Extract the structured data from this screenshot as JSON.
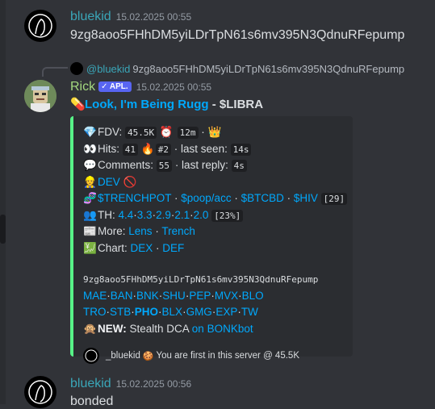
{
  "messages": [
    {
      "author": "bluekid",
      "timestamp": "15.02.2025 00:55",
      "text": "9zg8aoo5FHhDM5yiLDrTpN61s6mv395N3QdnuRFepump"
    },
    {
      "reply": {
        "author": "@bluekid",
        "text": "9zg8aoo5FHhDM5yiLDrTpN61s6mv395N3QdnuRFepump"
      },
      "author": "Rick",
      "badge": "APL.",
      "timestamp": "15.02.2025 00:55",
      "title": {
        "icon": "pill-icon",
        "link": "Look, I'm Being Rugg",
        "sep": " - ",
        "rest": "$LIBRA"
      },
      "embed": {
        "accent": "#57f287",
        "fdv": {
          "label": "FDV:",
          "value": "45.5K",
          "age": "12m"
        },
        "hits": {
          "label": "Hits:",
          "value": "41",
          "rank": "#2",
          "last_seen_label": "· last seen:",
          "last_seen": "14s"
        },
        "comments": {
          "label": "Comments:",
          "value": "55",
          "last_reply_label": "· last reply:",
          "last_reply": "4s"
        },
        "dev": {
          "label": "DEV"
        },
        "links_row": {
          "a": "$TRENCHPOT",
          "b": "$poop/acc",
          "c": "$BTCBD",
          "d": "$HIV",
          "count": "[29]"
        },
        "th": {
          "label": "TH:",
          "values": [
            "4.4",
            "3.3",
            "2.9",
            "2.1",
            "2.0"
          ],
          "pct": "[23%]"
        },
        "more": {
          "label": "More:",
          "a": "Lens",
          "b": "Trench"
        },
        "chart": {
          "label": "Chart:",
          "a": "DEX",
          "b": "DEF"
        },
        "address": "9zg8aoo5FHhDM5yiLDrTpN61s6mv395N3QdnuRFepump",
        "row1": [
          "MAE",
          "BAN",
          "BNK",
          "SHU",
          "PEP",
          "MVX",
          "BLO"
        ],
        "row2": [
          "TRO",
          "STB",
          "PHO",
          "BLX",
          "GMG",
          "EXP",
          "TW"
        ],
        "news": {
          "label": "NEW:",
          "text": " Stealth DCA ",
          "link": "on BONKbot"
        },
        "footer": {
          "author": "_bluekid",
          "text": "You are first in this server @ 45.5K"
        }
      }
    },
    {
      "author": "bluekid",
      "timestamp": "15.02.2025 00:56",
      "text": "bonded"
    }
  ],
  "colors": {
    "background": "#313338",
    "link": "#00a8fc",
    "rick_name": "#a4d97f",
    "bluekid_name": "#3aa6b8",
    "badge": "#5865f2"
  }
}
